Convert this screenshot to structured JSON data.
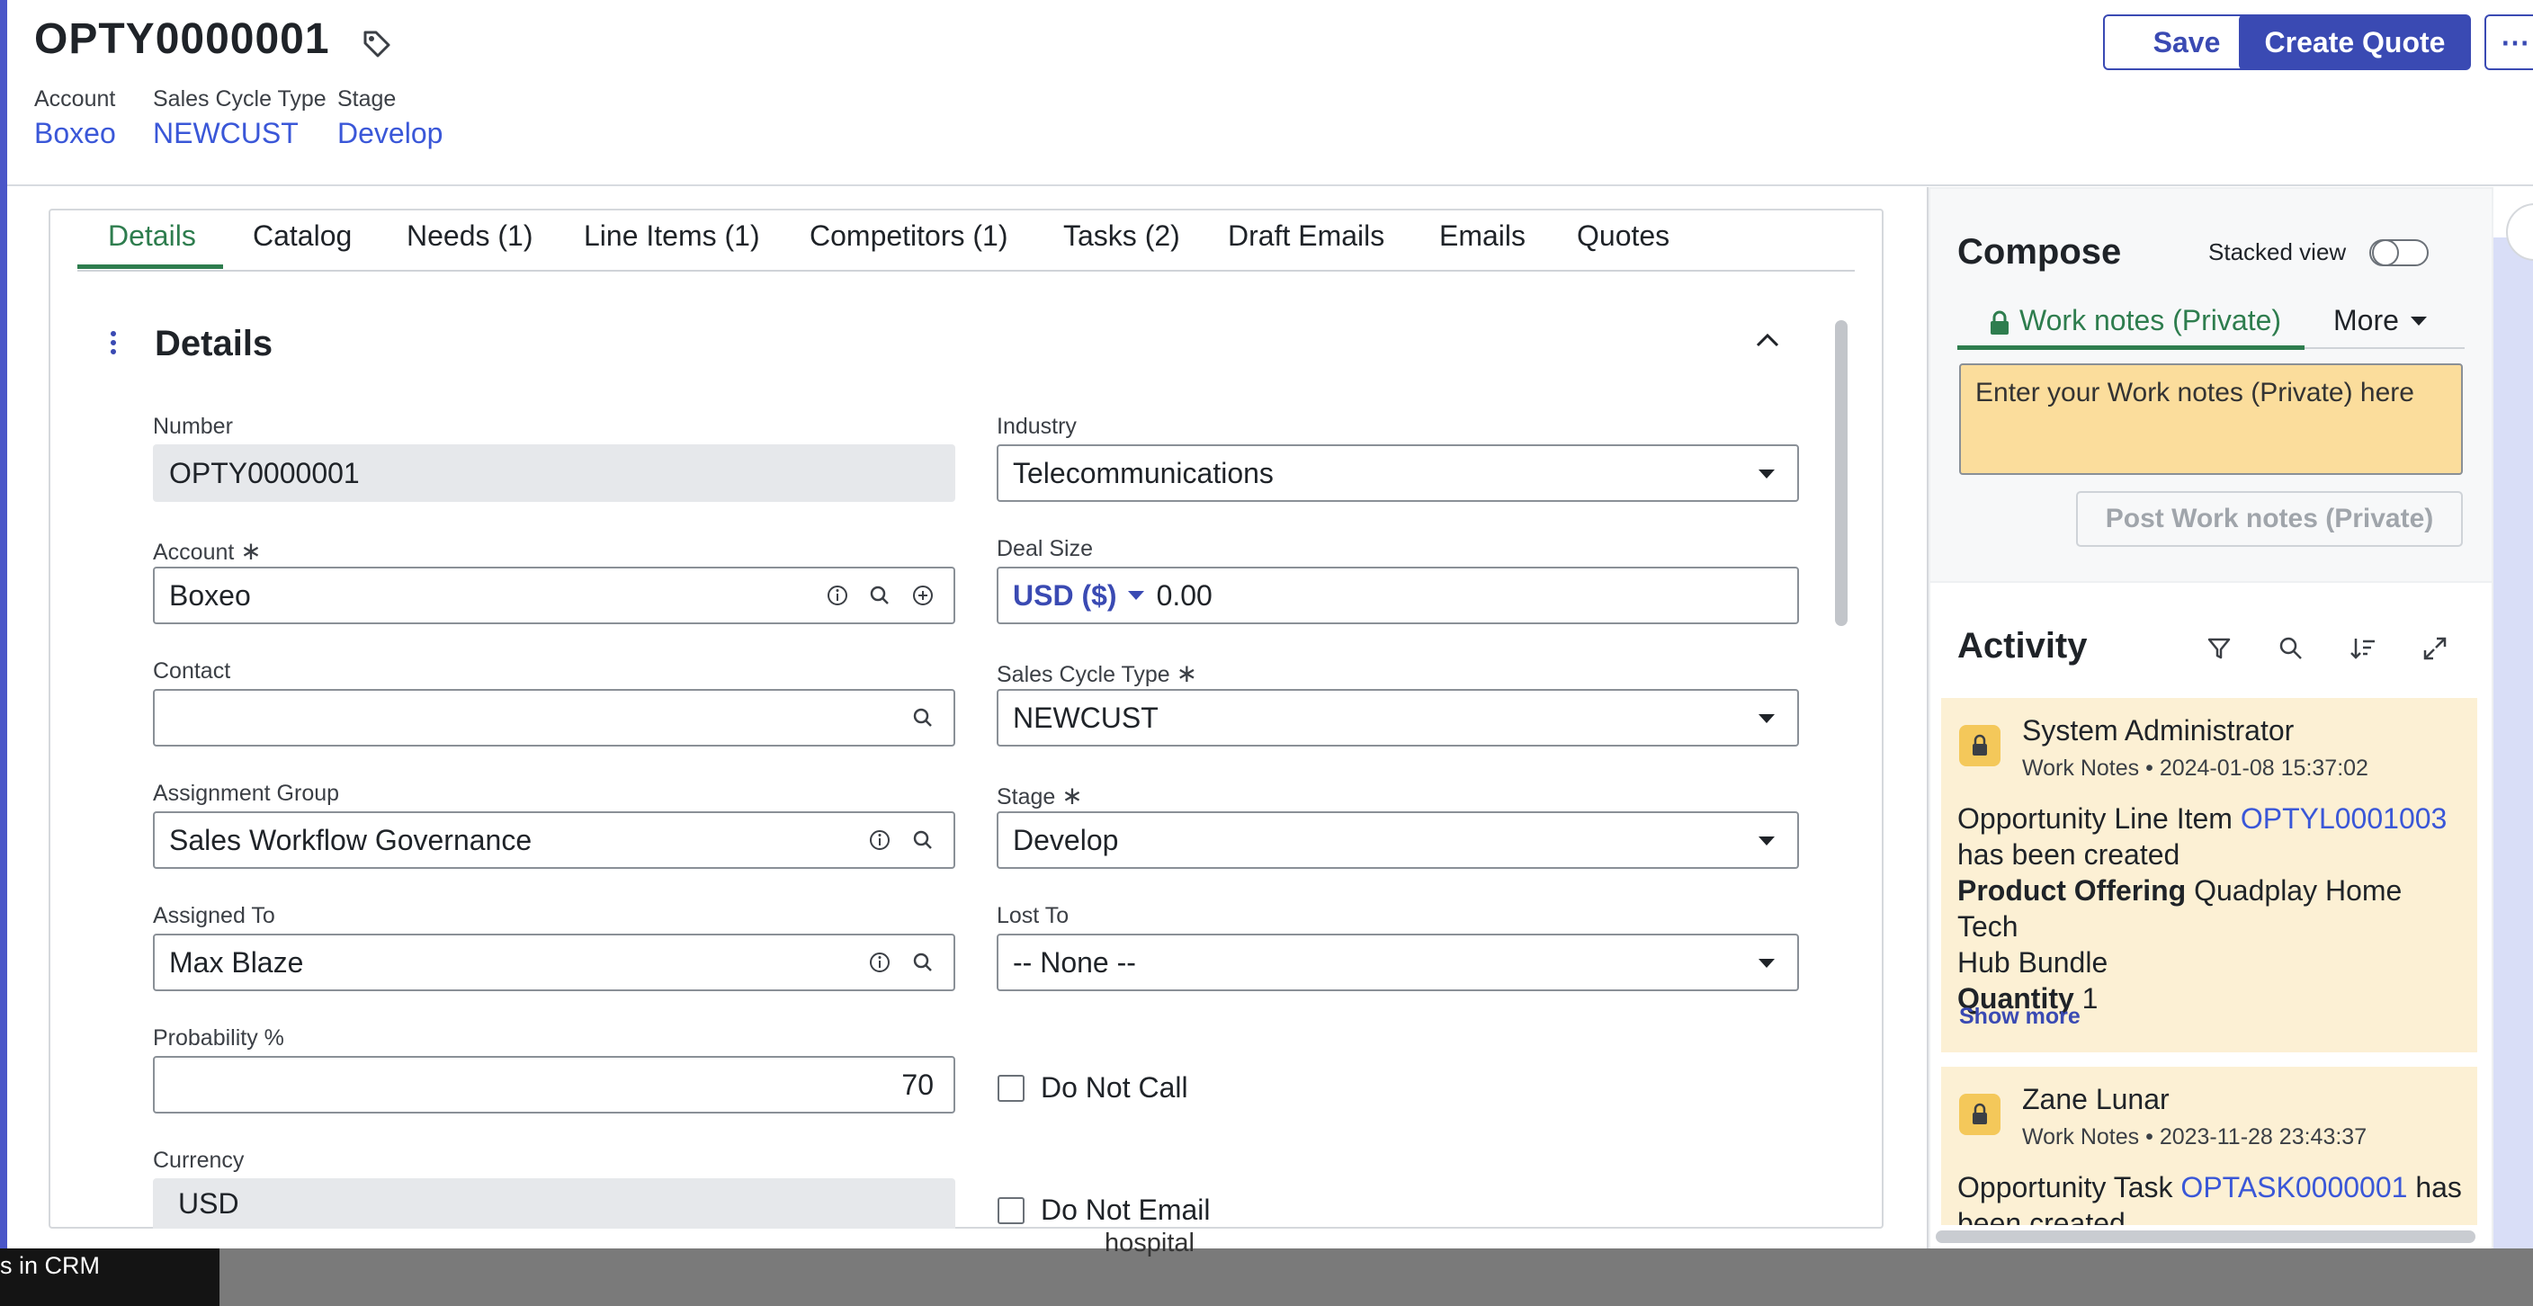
{
  "header": {
    "title": "OPTY0000001",
    "account_label": "Account",
    "account_value": "Boxeo",
    "cycle_label": "Sales Cycle Type",
    "cycle_value": "NEWCUST",
    "stage_label": "Stage",
    "stage_value": "Develop",
    "save_label": "Save",
    "create_quote_label": "Create Quote",
    "more_label": "⋯"
  },
  "tabs": [
    "Details",
    "Catalog",
    "Needs (1)",
    "Line Items (1)",
    "Competitors (1)",
    "Tasks (2)",
    "Draft Emails",
    "Emails",
    "Quotes"
  ],
  "section": {
    "title": "Details"
  },
  "form": {
    "number": {
      "label": "Number",
      "value": "OPTY0000001"
    },
    "account": {
      "label": "Account",
      "value": "Boxeo"
    },
    "contact": {
      "label": "Contact",
      "value": ""
    },
    "assignment_group": {
      "label": "Assignment Group",
      "value": "Sales Workflow Governance"
    },
    "assigned_to": {
      "label": "Assigned To",
      "value": "Max Blaze"
    },
    "probability": {
      "label": "Probability %",
      "value": "70"
    },
    "currency": {
      "label": "Currency",
      "value": "USD"
    },
    "industry": {
      "label": "Industry",
      "value": "Telecommunications"
    },
    "deal_size": {
      "label": "Deal Size",
      "currency": "USD ($)",
      "value": "0.00"
    },
    "sales_cycle_type": {
      "label": "Sales Cycle Type",
      "value": "NEWCUST"
    },
    "stage": {
      "label": "Stage",
      "value": "Develop"
    },
    "lost_to": {
      "label": "Lost To",
      "value": "-- None --"
    },
    "do_not_call": {
      "label": "Do Not Call",
      "checked": false
    },
    "do_not_email": {
      "label": "Do Not Email",
      "checked": false
    },
    "required_mark": "∗"
  },
  "compose": {
    "title": "Compose",
    "stacked_label": "Stacked view",
    "stacked_on": false,
    "tab_worknotes": "Work notes (Private)",
    "tab_more": "More",
    "placeholder": "Enter your Work notes (Private) here",
    "post_label": "Post Work notes (Private)"
  },
  "activity": {
    "title": "Activity",
    "show_more": "Show more",
    "entries": [
      {
        "author": "System Administrator",
        "type": "Work Notes",
        "sep": "•",
        "time": "2024-01-08 15:37:02",
        "line1_prefix": "Opportunity Line Item ",
        "line1_link": "OPTYL0001003",
        "line2": "has been created",
        "line3_label": "Product Offering",
        "line3_value": " Quadplay Home Tech",
        "line4": "Hub Bundle",
        "line5_label": "Quantity",
        "line5_value": " 1"
      },
      {
        "author": "Zane Lunar",
        "type": "Work Notes",
        "sep": "•",
        "time": "2023-11-28 23:43:37",
        "line1_prefix": "Opportunity Task ",
        "line1_link": "OPTASK0000001",
        "line1_suffix": " has",
        "line2": "been created"
      }
    ]
  },
  "background": {
    "taskbar_left_text": "s in CRM",
    "taskbar_mid_text": "hospital"
  },
  "colors": {
    "accent": "#3a4ab3",
    "link": "#3a57d8",
    "active_tab": "#2e7d4e",
    "note_bg": "#fbdd9c",
    "card_bg": "#fcf0d4"
  }
}
